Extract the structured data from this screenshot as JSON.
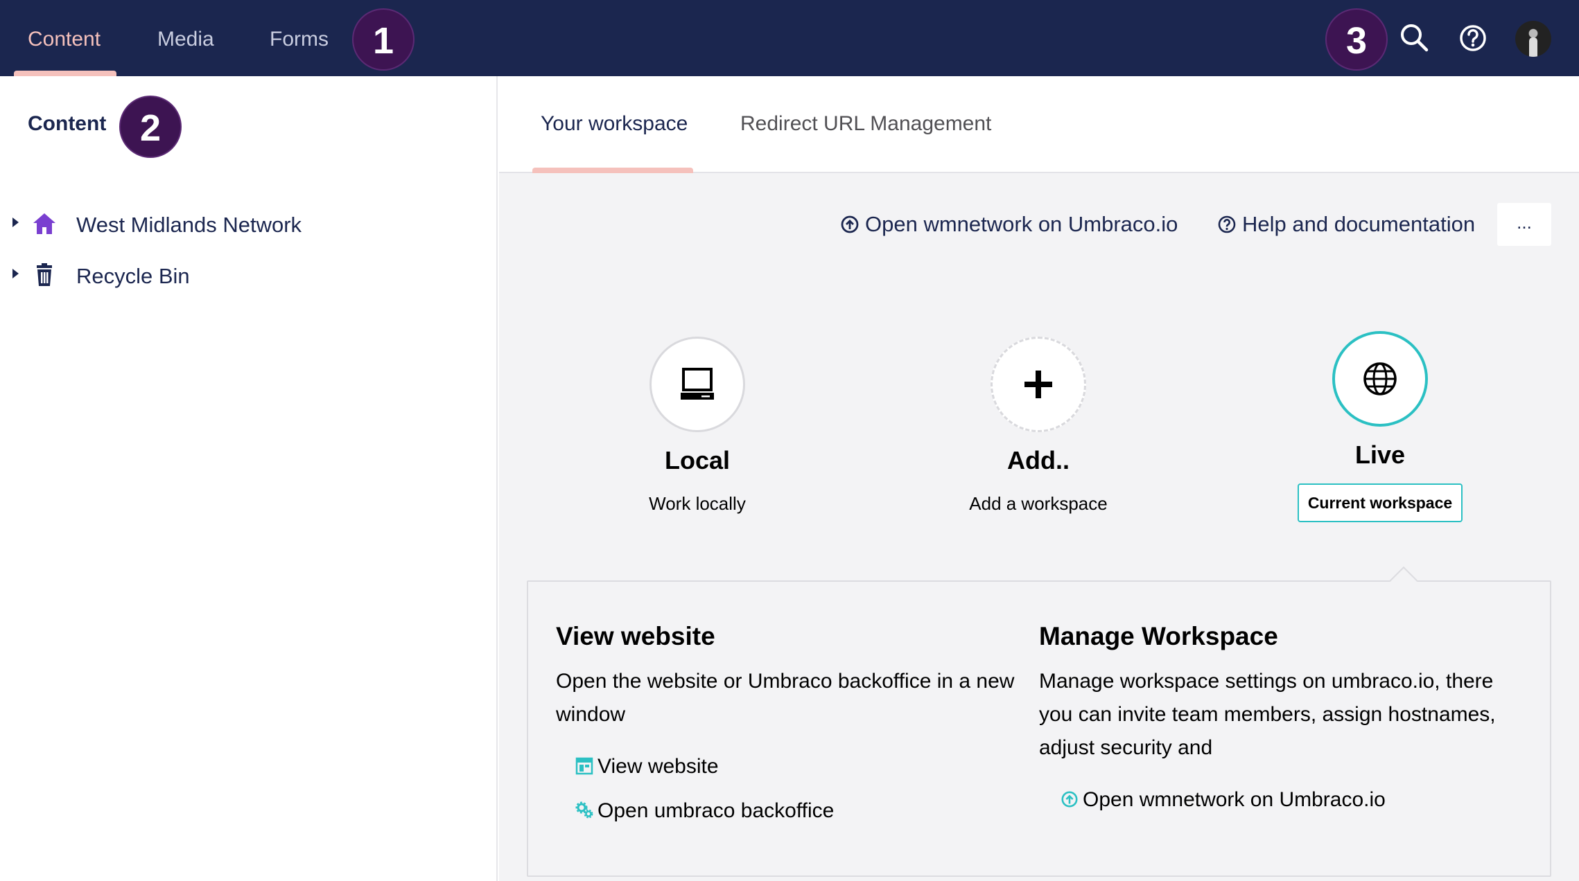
{
  "topnav": {
    "items": [
      {
        "label": "Content",
        "active": true
      },
      {
        "label": "Media",
        "active": false
      },
      {
        "label": "Forms",
        "active": false
      }
    ],
    "icons": [
      "search-icon",
      "help-icon",
      "user-avatar"
    ]
  },
  "badges": {
    "one": "1",
    "two": "2",
    "three": "3"
  },
  "sidebar": {
    "title": "Content",
    "items": [
      {
        "label": "West Midlands Network",
        "icon": "home-icon"
      },
      {
        "label": "Recycle Bin",
        "icon": "trash-icon"
      }
    ]
  },
  "tabs": [
    {
      "label": "Your workspace",
      "active": true
    },
    {
      "label": "Redirect URL Management",
      "active": false
    }
  ],
  "actions": {
    "open_cloud": "Open wmnetwork on Umbraco.io",
    "help": "Help and documentation",
    "more": "..."
  },
  "workspaces": [
    {
      "name": "Local",
      "description": "Work locally",
      "icon": "laptop-icon"
    },
    {
      "name": "Add..",
      "description": "Add a workspace",
      "icon": "plus-icon"
    },
    {
      "name": "Live",
      "current_label": "Current workspace",
      "icon": "globe-icon"
    }
  ],
  "panel": {
    "view": {
      "title": "View website",
      "text": "Open the website or Umbraco backoffice in a new window",
      "links": [
        "View website",
        "Open umbraco backoffice"
      ]
    },
    "manage": {
      "title": "Manage Workspace",
      "text": "Manage workspace settings on umbraco.io, there you can invite team members, assign hostnames, adjust security and",
      "link": "Open wmnetwork on Umbraco.io"
    }
  },
  "colors": {
    "nav_bg": "#1b264f",
    "accent_pink": "#f5c1bc",
    "teal": "#2bc0c3",
    "badge_purple": "#3d1452"
  }
}
